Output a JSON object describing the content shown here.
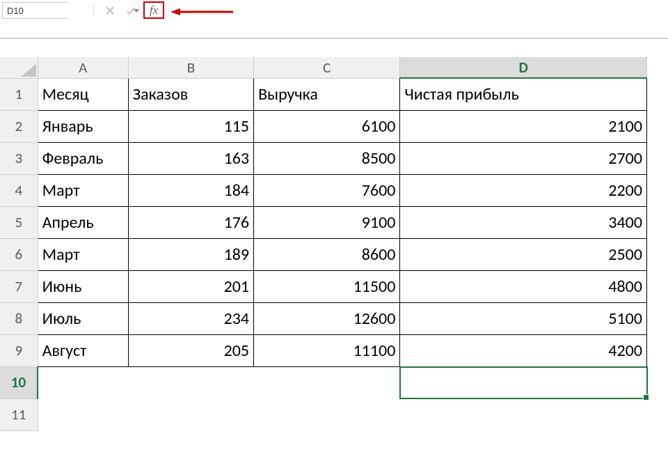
{
  "formula_bar": {
    "name_box": "D10",
    "fx_label": "fx",
    "fx_icon": "function-icon",
    "cancel_icon": "cancel-icon",
    "enter_icon": "enter-icon",
    "dropdown_icon": "chevron-down-icon",
    "formula_value": "",
    "annotation_color": "#cc0000"
  },
  "columns": [
    "A",
    "B",
    "C",
    "D"
  ],
  "selected_column": "D",
  "selected_row": 10,
  "active_cell": "D10",
  "header_row": {
    "A": "Месяц",
    "B": "Заказов",
    "C": "Выручка",
    "D": "Чистая прибыль"
  },
  "rows": [
    {
      "n": 2,
      "A": "Январь",
      "B": 115,
      "C": 6100,
      "D": 2100
    },
    {
      "n": 3,
      "A": "Февраль",
      "B": 163,
      "C": 8500,
      "D": 2700
    },
    {
      "n": 4,
      "A": "Март",
      "B": 184,
      "C": 7600,
      "D": 2200
    },
    {
      "n": 5,
      "A": "Апрель",
      "B": 176,
      "C": 9100,
      "D": 3400
    },
    {
      "n": 6,
      "A": "Март",
      "B": 189,
      "C": 8600,
      "D": 2500
    },
    {
      "n": 7,
      "A": "Июнь",
      "B": 201,
      "C": 11500,
      "D": 4800
    },
    {
      "n": 8,
      "A": "Июль",
      "B": 234,
      "C": 12600,
      "D": 5100
    },
    {
      "n": 9,
      "A": "Август",
      "B": 205,
      "C": 11100,
      "D": 4200
    }
  ],
  "empty_rows_after": [
    10,
    11
  ],
  "colors": {
    "header_fill": "#6aa84f",
    "selection_accent": "#217346"
  },
  "chart_data": {
    "type": "table",
    "columns": [
      "Месяц",
      "Заказов",
      "Выручка",
      "Чистая прибыль"
    ],
    "rows": [
      [
        "Январь",
        115,
        6100,
        2100
      ],
      [
        "Февраль",
        163,
        8500,
        2700
      ],
      [
        "Март",
        184,
        7600,
        2200
      ],
      [
        "Апрель",
        176,
        9100,
        3400
      ],
      [
        "Март",
        189,
        8600,
        2500
      ],
      [
        "Июнь",
        201,
        11500,
        4800
      ],
      [
        "Июль",
        234,
        12600,
        5100
      ],
      [
        "Август",
        205,
        11100,
        4200
      ]
    ]
  }
}
